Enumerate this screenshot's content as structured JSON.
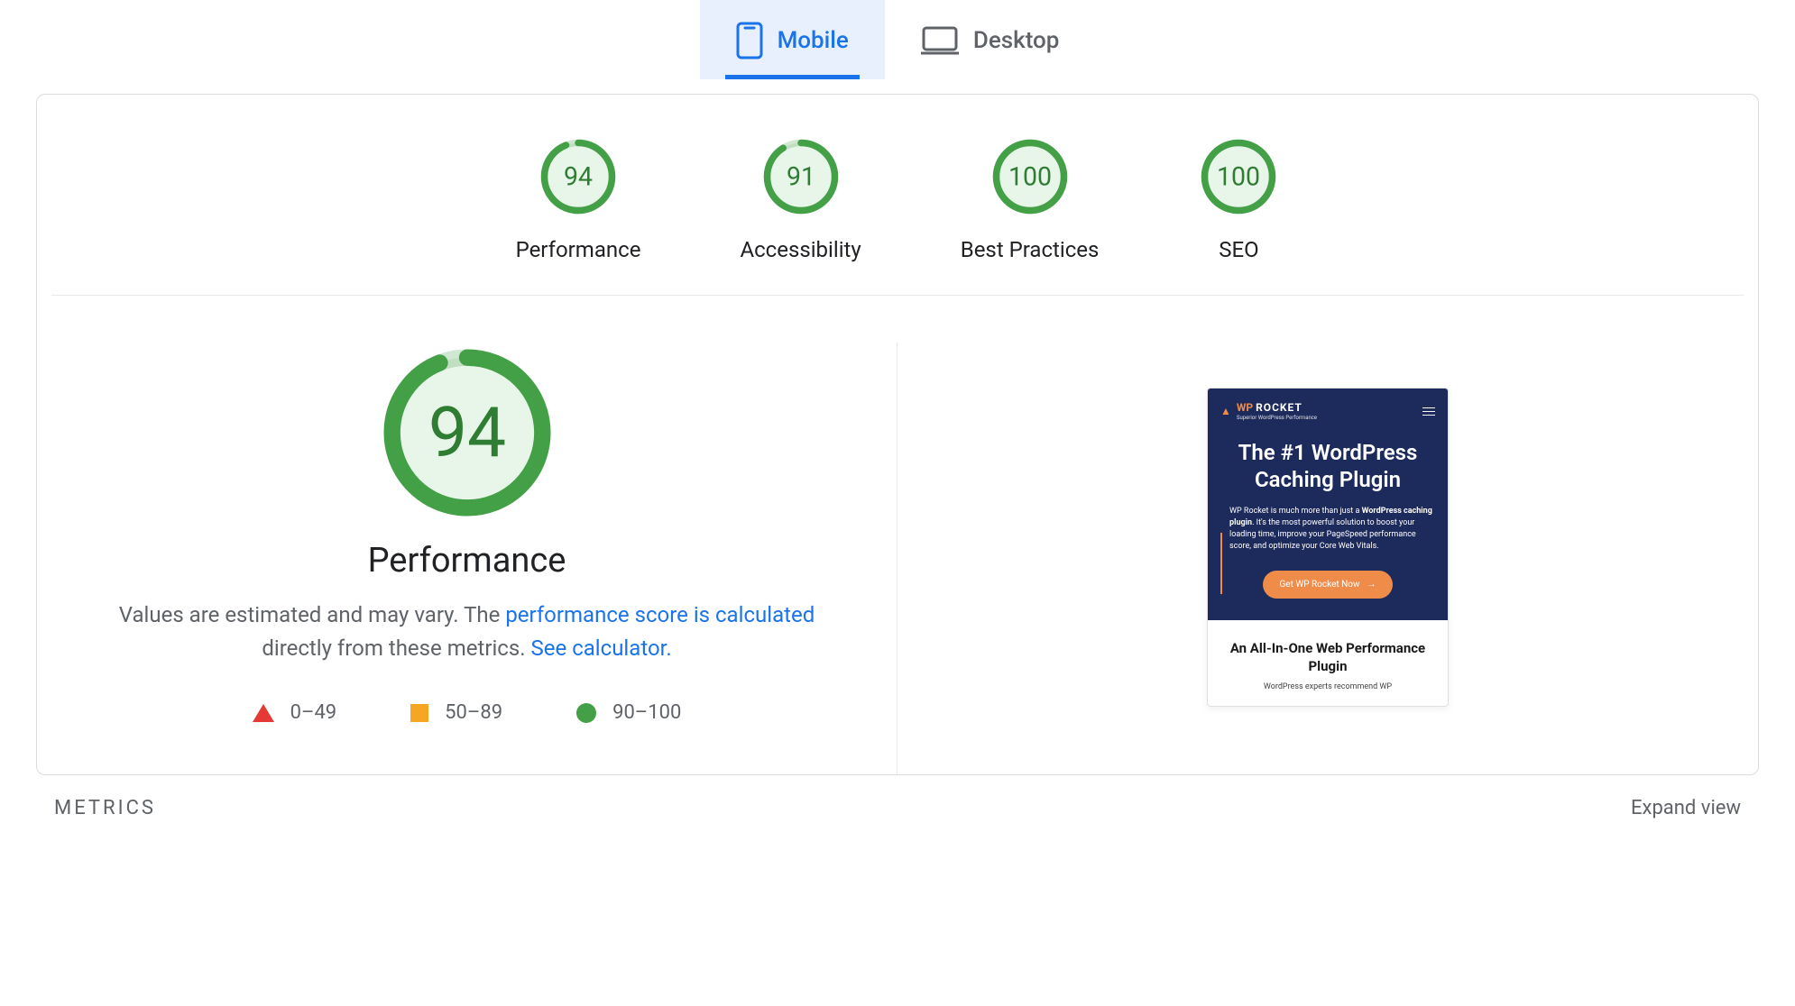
{
  "tabs": {
    "mobile": "Mobile",
    "desktop": "Desktop",
    "active": "mobile"
  },
  "gauges": [
    {
      "score": 94,
      "label": "Performance"
    },
    {
      "score": 91,
      "label": "Accessibility"
    },
    {
      "score": 100,
      "label": "Best Practices"
    },
    {
      "score": 100,
      "label": "SEO"
    }
  ],
  "detail": {
    "score": 94,
    "title": "Performance",
    "desc_prefix": "Values are estimated and may vary. The ",
    "link1": "performance score is calculated",
    "desc_mid": " directly from these metrics. ",
    "link2": "See calculator."
  },
  "legend": {
    "range_fail": "0–49",
    "range_avg": "50–89",
    "range_good": "90–100"
  },
  "preview": {
    "brand_wp": "WP",
    "brand_rocket": "ROCKET",
    "brand_sub": "Superior WordPress Performance",
    "headline": "The #1 WordPress Caching Plugin",
    "body_pre": "WP Rocket is much more than just a ",
    "body_bold": "WordPress caching plugin",
    "body_post": ". It's the most powerful solution to boost your loading time, improve your PageSpeed performance score, and optimize your Core Web Vitals.",
    "cta": "Get WP Rocket Now",
    "sub_title": "An All-In-One Web Performance Plugin",
    "sub_tag": "WordPress experts recommend WP"
  },
  "metrics": {
    "label": "METRICS",
    "expand": "Expand view"
  },
  "colors": {
    "good": "#43a047",
    "good_bg": "#e8f5e9",
    "good_text": "#2e7d32",
    "avg": "#f5a623",
    "fail": "#e53935",
    "accent": "#1a73e8"
  }
}
